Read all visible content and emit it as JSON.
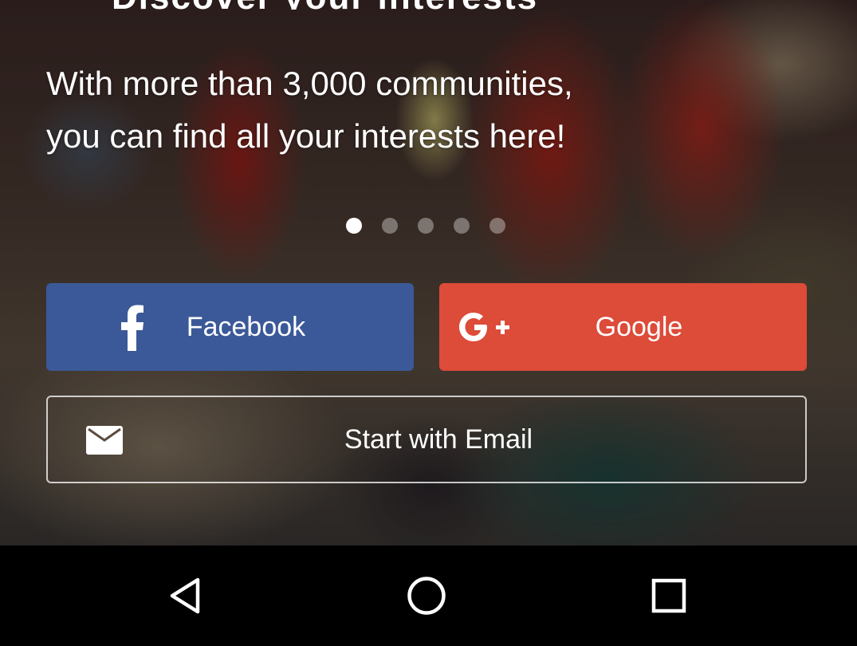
{
  "hero": {
    "headline_partial": "Discover your interests",
    "tagline_line1": "With more than 3,000 communities,",
    "tagline_line2": "you can find all your interests here!"
  },
  "pager": {
    "total": 5,
    "active_index": 0
  },
  "auth": {
    "facebook": {
      "label": "Facebook",
      "icon": "facebook-icon",
      "color": "#3b5998"
    },
    "google": {
      "label": "Google",
      "icon": "google-plus-icon",
      "color": "#dd4b39"
    },
    "email": {
      "label": "Start with Email",
      "icon": "envelope-icon"
    }
  },
  "system_nav": {
    "back_icon": "back-triangle-icon",
    "home_icon": "home-circle-icon",
    "recents_icon": "recents-square-icon"
  }
}
